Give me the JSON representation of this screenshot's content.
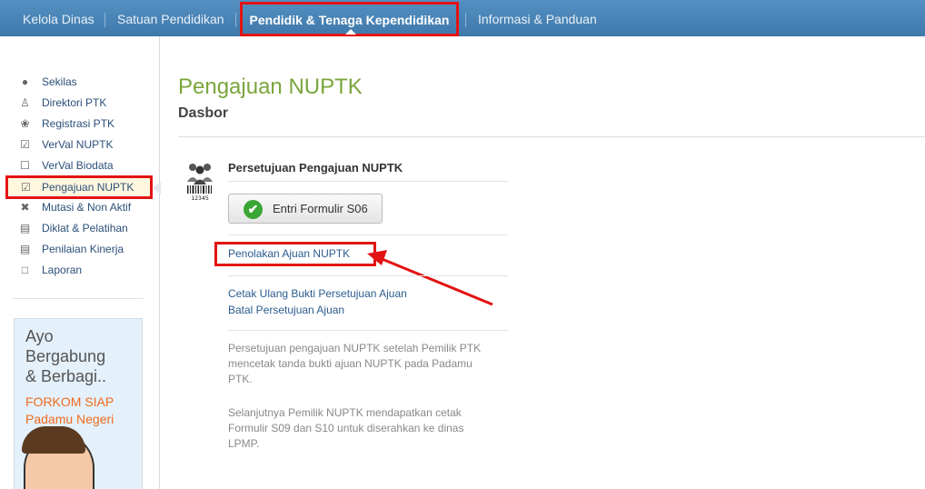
{
  "nav": {
    "items": [
      "Kelola Dinas",
      "Satuan Pendidikan",
      "Pendidik & Tenaga Kependidikan",
      "Informasi & Panduan"
    ]
  },
  "sidebar": {
    "items": [
      {
        "label": "Sekilas",
        "icon": "info-icon"
      },
      {
        "label": "Direktori PTK",
        "icon": "user-icon"
      },
      {
        "label": "Registrasi PTK",
        "icon": "register-icon"
      },
      {
        "label": "VerVal NUPTK",
        "icon": "clipboard-check-icon"
      },
      {
        "label": "VerVal Biodata",
        "icon": "clipboard-icon"
      },
      {
        "label": "Pengajuan NUPTK",
        "icon": "clipboard-check-icon"
      },
      {
        "label": "Mutasi & Non Aktif",
        "icon": "close-icon"
      },
      {
        "label": "Diklat & Pelatihan",
        "icon": "chart-icon"
      },
      {
        "label": "Penilaian Kinerja",
        "icon": "chart-icon"
      },
      {
        "label": "Laporan",
        "icon": "document-icon"
      }
    ],
    "promo": {
      "line1": "Ayo",
      "line2": "Bergabung",
      "line3": "& Berbagi..",
      "line4": "FORKOM SIAP",
      "line5": "Padamu Negeri"
    }
  },
  "main": {
    "title": "Pengajuan NUPTK",
    "subtitle": "Dasbor",
    "card_title": "Persetujuan Pengajuan NUPTK",
    "icon_number": "12345",
    "button_label": "Entri Formulir S06",
    "link_reject": "Penolakan Ajuan NUPTK",
    "link_reprint": "Cetak Ulang Bukti Persetujuan Ajuan",
    "link_cancel": "Batal Persetujuan Ajuan",
    "desc1_l1": "Persetujuan pengajuan NUPTK setelah Pemilik PTK",
    "desc1_l2": "mencetak tanda bukti ajuan NUPTK pada Padamu",
    "desc1_l3": "PTK.",
    "desc2_l1": "Selanjutnya Pemilik NUPTK mendapatkan cetak",
    "desc2_l2": "Formulir S09 dan S10 untuk diserahkan ke dinas",
    "desc2_l3": "LPMP."
  },
  "colors": {
    "nav_bg": "#4a84b5",
    "highlight": "#e21313",
    "title_green": "#7ba53c",
    "link_blue": "#2b5c8f"
  }
}
